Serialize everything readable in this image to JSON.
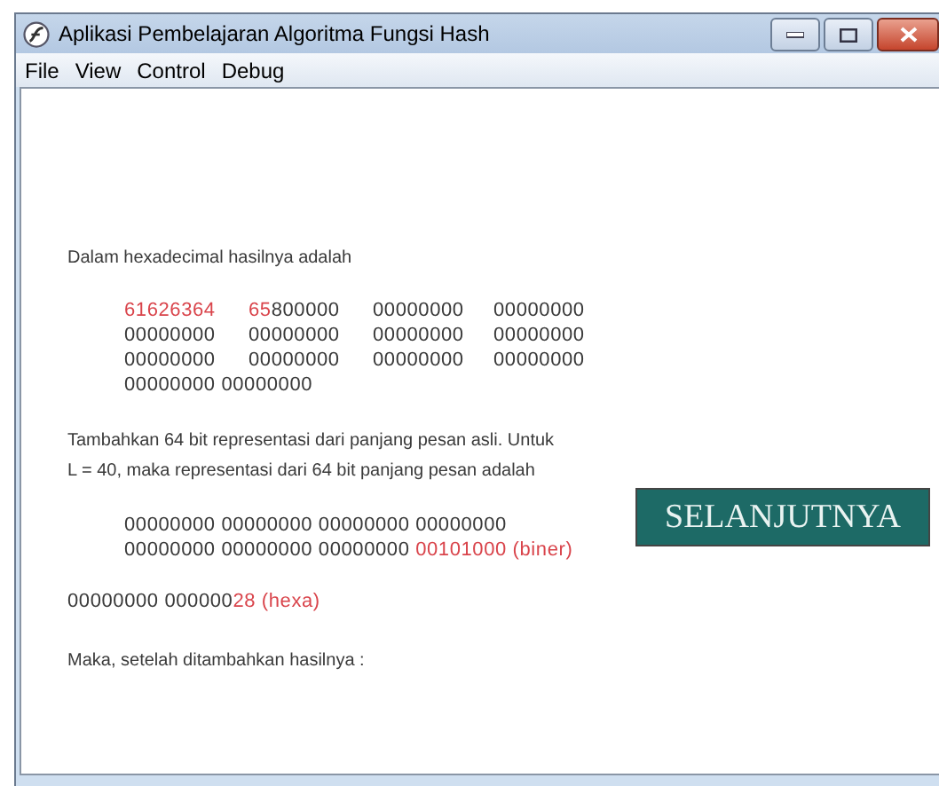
{
  "window": {
    "title": "Aplikasi Pembelajaran Algoritma Fungsi Hash"
  },
  "menu": [
    "File",
    "View",
    "Control",
    "Debug"
  ],
  "intro": "Dalam hexadecimal hasilnya adalah",
  "hex_grid": [
    [
      [
        {
          "text": "61626364",
          "highlight": true
        }
      ],
      [
        {
          "text": "65",
          "highlight": true
        },
        {
          "text": "800000",
          "highlight": false
        }
      ],
      [
        {
          "text": "00000000",
          "highlight": false
        }
      ],
      [
        {
          "text": "00000000",
          "highlight": false
        }
      ]
    ],
    [
      [
        {
          "text": "00000000",
          "highlight": false
        }
      ],
      [
        {
          "text": "00000000",
          "highlight": false
        }
      ],
      [
        {
          "text": "00000000",
          "highlight": false
        }
      ],
      [
        {
          "text": "00000000",
          "highlight": false
        }
      ]
    ],
    [
      [
        {
          "text": "00000000",
          "highlight": false
        }
      ],
      [
        {
          "text": "00000000",
          "highlight": false
        }
      ],
      [
        {
          "text": "00000000",
          "highlight": false
        }
      ],
      [
        {
          "text": "00000000",
          "highlight": false
        }
      ]
    ]
  ],
  "hex_last_line": [
    {
      "text": "00000000 00000000",
      "highlight": false
    }
  ],
  "paragraph": [
    "Tambahkan 64 bit representasi dari panjang pesan asli. Untuk",
    "L = 40, maka representasi dari 64 bit panjang pesan adalah"
  ],
  "binary_lines": [
    [
      {
        "text": "00000000 00000000 00000000 00000000",
        "highlight": false
      }
    ],
    [
      {
        "text": "00000000 00000000 00000000 ",
        "highlight": false
      },
      {
        "text": "00101000 (biner)",
        "highlight": true
      }
    ]
  ],
  "hexa_line": [
    {
      "text": "00000000 000000",
      "highlight": false
    },
    {
      "text": "28 (hexa)",
      "highlight": true
    }
  ],
  "closing": "Maka, setelah ditambahkan hasilnya :",
  "next_button": "SELANJUTNYA"
}
